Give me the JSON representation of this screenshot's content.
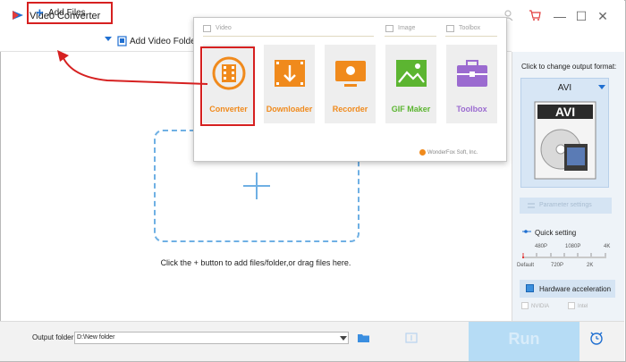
{
  "window": {
    "title": "Video Converter",
    "controls": [
      "—",
      "☐",
      "✕"
    ]
  },
  "toolbar": {
    "add_files_label": "Add Files",
    "add_video_folder_label": "Add Video Folder"
  },
  "main": {
    "hint": "Click the + button to add files/folder,or drag files here."
  },
  "popup": {
    "sections": {
      "video": "Video",
      "image": "Image",
      "toolbox": "Toolbox"
    },
    "tiles": [
      {
        "label": "Converter",
        "color": "#f08a1c"
      },
      {
        "label": "Downloader",
        "color": "#f08a1c"
      },
      {
        "label": "Recorder",
        "color": "#f08a1c"
      },
      {
        "label": "GIF Maker",
        "color": "#5cb531"
      },
      {
        "label": "Toolbox",
        "color": "#9b6bd0"
      }
    ],
    "brand": "WonderFox Soft, Inc."
  },
  "right_panel": {
    "caption": "Click to change output format:",
    "format": "AVI",
    "format_image_text": "AVI",
    "parameter_settings": "Parameter settings",
    "quick_setting": "Quick setting",
    "ticks_top": [
      "480P",
      "1080P",
      "4K"
    ],
    "ticks_bottom": [
      "Default",
      "720P",
      "2K"
    ],
    "quality_level": 0.0,
    "hardware_acceleration": "Hardware acceleration",
    "gpu_nvidia": "NVIDIA",
    "gpu_intel": "Intel"
  },
  "bottom": {
    "output_folder_label": "Output folder:",
    "output_folder_value": "D:\\New folder",
    "run_label": "Run"
  },
  "colors": {
    "accent": "#1f6fd1",
    "highlight_red": "#d62020",
    "run_button": "#b6dcf5"
  }
}
